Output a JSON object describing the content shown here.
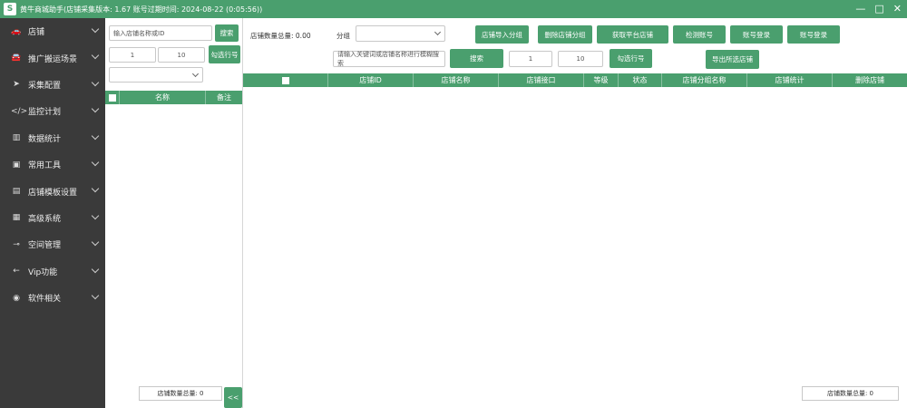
{
  "titlebar": {
    "logo": "S",
    "title": "黄牛商城助手(店铺采集版本: 1.67 账号过期时间: 2024-08-22 (0:05:56))",
    "minimize": "—",
    "maximize": "□",
    "close": "✕"
  },
  "sidebar": {
    "items": [
      {
        "label": "店铺",
        "icon": "car-icon",
        "glyph": "🚗"
      },
      {
        "label": "推广搬运场景",
        "icon": "car-icon",
        "glyph": "🚘"
      },
      {
        "label": "采集配置",
        "icon": "send-icon",
        "glyph": "➤"
      },
      {
        "label": "监控计划",
        "icon": "code-icon",
        "glyph": "</>"
      },
      {
        "label": "数据统计",
        "icon": "chart-icon",
        "glyph": "▥"
      },
      {
        "label": "常用工具",
        "icon": "book-icon",
        "glyph": "▣"
      },
      {
        "label": "店铺模板设置",
        "icon": "briefcase-icon",
        "glyph": "▤"
      },
      {
        "label": "高级系统",
        "icon": "bank-icon",
        "glyph": "▦"
      },
      {
        "label": "空间管理",
        "icon": "key-icon",
        "glyph": "⊸"
      },
      {
        "label": "Vip功能",
        "icon": "arrow-left-icon",
        "glyph": "←"
      },
      {
        "label": "软件相关",
        "icon": "info-circle-icon",
        "glyph": "◉"
      }
    ]
  },
  "left_panel": {
    "search_placeholder": "输入店铺名称或ID",
    "search_button": "搜索",
    "range_from": "1",
    "range_to": "10",
    "pick_button": "勾选行号",
    "select_value": "",
    "table_headers": [
      "名称",
      "备注"
    ],
    "count_label": "店铺数量总量: 0",
    "collapse_button": "<<"
  },
  "main": {
    "total_label": "店铺数量总量: 0.00",
    "group_label": "分组",
    "group_value": "",
    "buttons_row1": [
      "店铺导入分组",
      "删除店铺分组",
      "获取平台店铺",
      "检测账号",
      "账号登录",
      "账号登录"
    ],
    "search_placeholder": "请输入关键词或店铺名称进行模糊搜索",
    "search_button": "搜索",
    "range_from": "1",
    "range_to": "10",
    "pick_button": "勾选行号",
    "export_button": "导出所选店铺",
    "table_headers": [
      "店铺ID",
      "店铺名称",
      "店铺接口",
      "等级",
      "状态",
      "店铺分组名称",
      "店铺统计",
      "删除店铺"
    ],
    "count_label": "店铺数量总量: 0"
  }
}
